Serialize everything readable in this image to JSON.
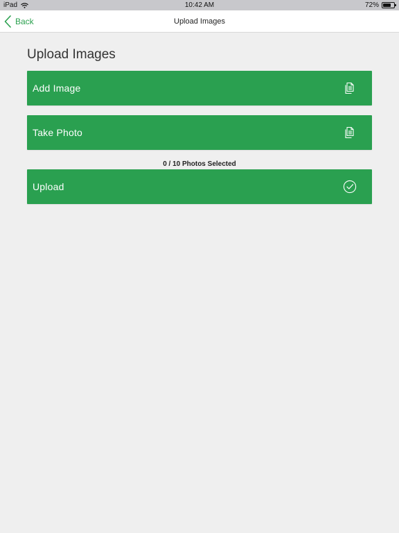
{
  "status_bar": {
    "device": "iPad",
    "time": "10:42 AM",
    "battery_text": "72%",
    "battery_level": 0.72
  },
  "nav": {
    "back_label": "Back",
    "title": "Upload Images"
  },
  "main": {
    "heading": "Upload Images",
    "add_image_label": "Add Image",
    "take_photo_label": "Take Photo",
    "selected_count": "0 / 10 Photos Selected",
    "upload_label": "Upload"
  },
  "icons": {
    "add_image": "documents-icon",
    "take_photo": "documents-icon",
    "upload": "check-circle-icon",
    "back": "chevron-left-icon"
  },
  "colors": {
    "accent": "#2aa050",
    "nav_link": "#2aa04e",
    "background": "#efefef"
  }
}
